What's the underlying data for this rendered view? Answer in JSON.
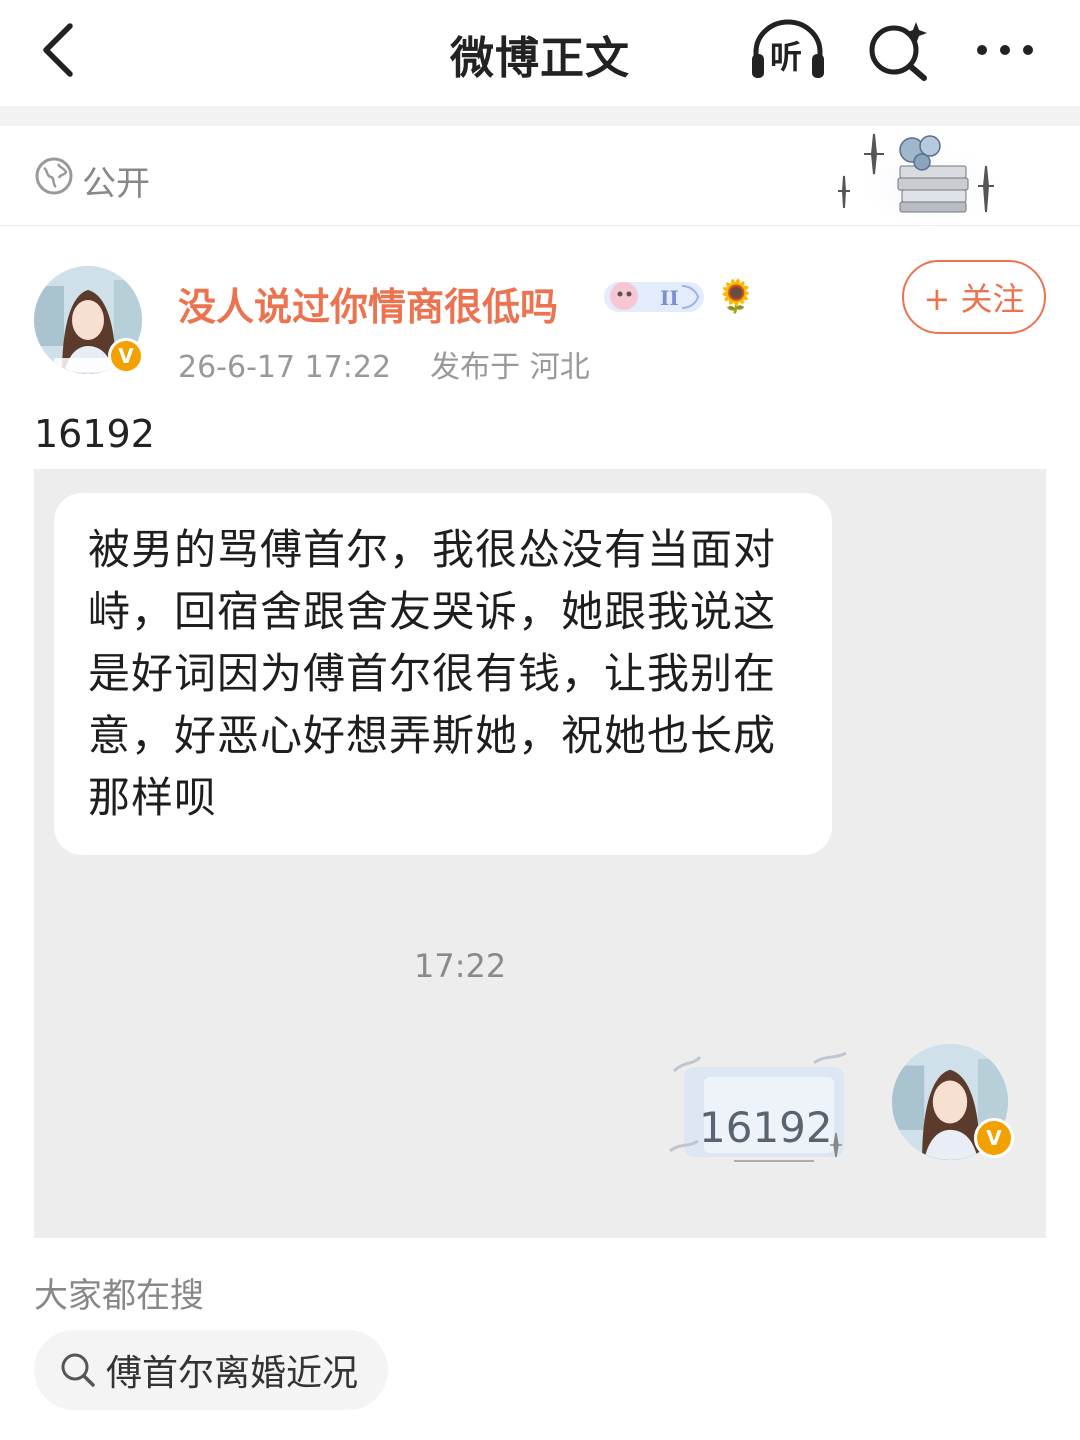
{
  "nav": {
    "title": "微博正文",
    "listen_label": "听"
  },
  "visibility": {
    "label": "公开"
  },
  "post": {
    "author": "没人说过你情商很低吗",
    "verified_badge": "V",
    "timestamp": "26-6-17 17:22",
    "location": "发布于 河北",
    "follow_label": "+ 关注",
    "text": "16192",
    "image": {
      "bubble_text": "被男的骂傅首尔，我很怂没有当面对峙，回宿舍跟舍友哭诉，她跟我说这是好词因为傅首尔很有钱，让我别在意，好恶心好想弄斯她，祝她也长成那样呗",
      "time": "17:22",
      "reply_text": "16192"
    }
  },
  "trending": {
    "title": "大家都在搜",
    "items": [
      {
        "label": "傅首尔离婚近况",
        "icon": "search-icon"
      }
    ]
  },
  "colors": {
    "brand": "#eb7350",
    "verified": "#f2a100",
    "image_bg": "#ededed"
  }
}
